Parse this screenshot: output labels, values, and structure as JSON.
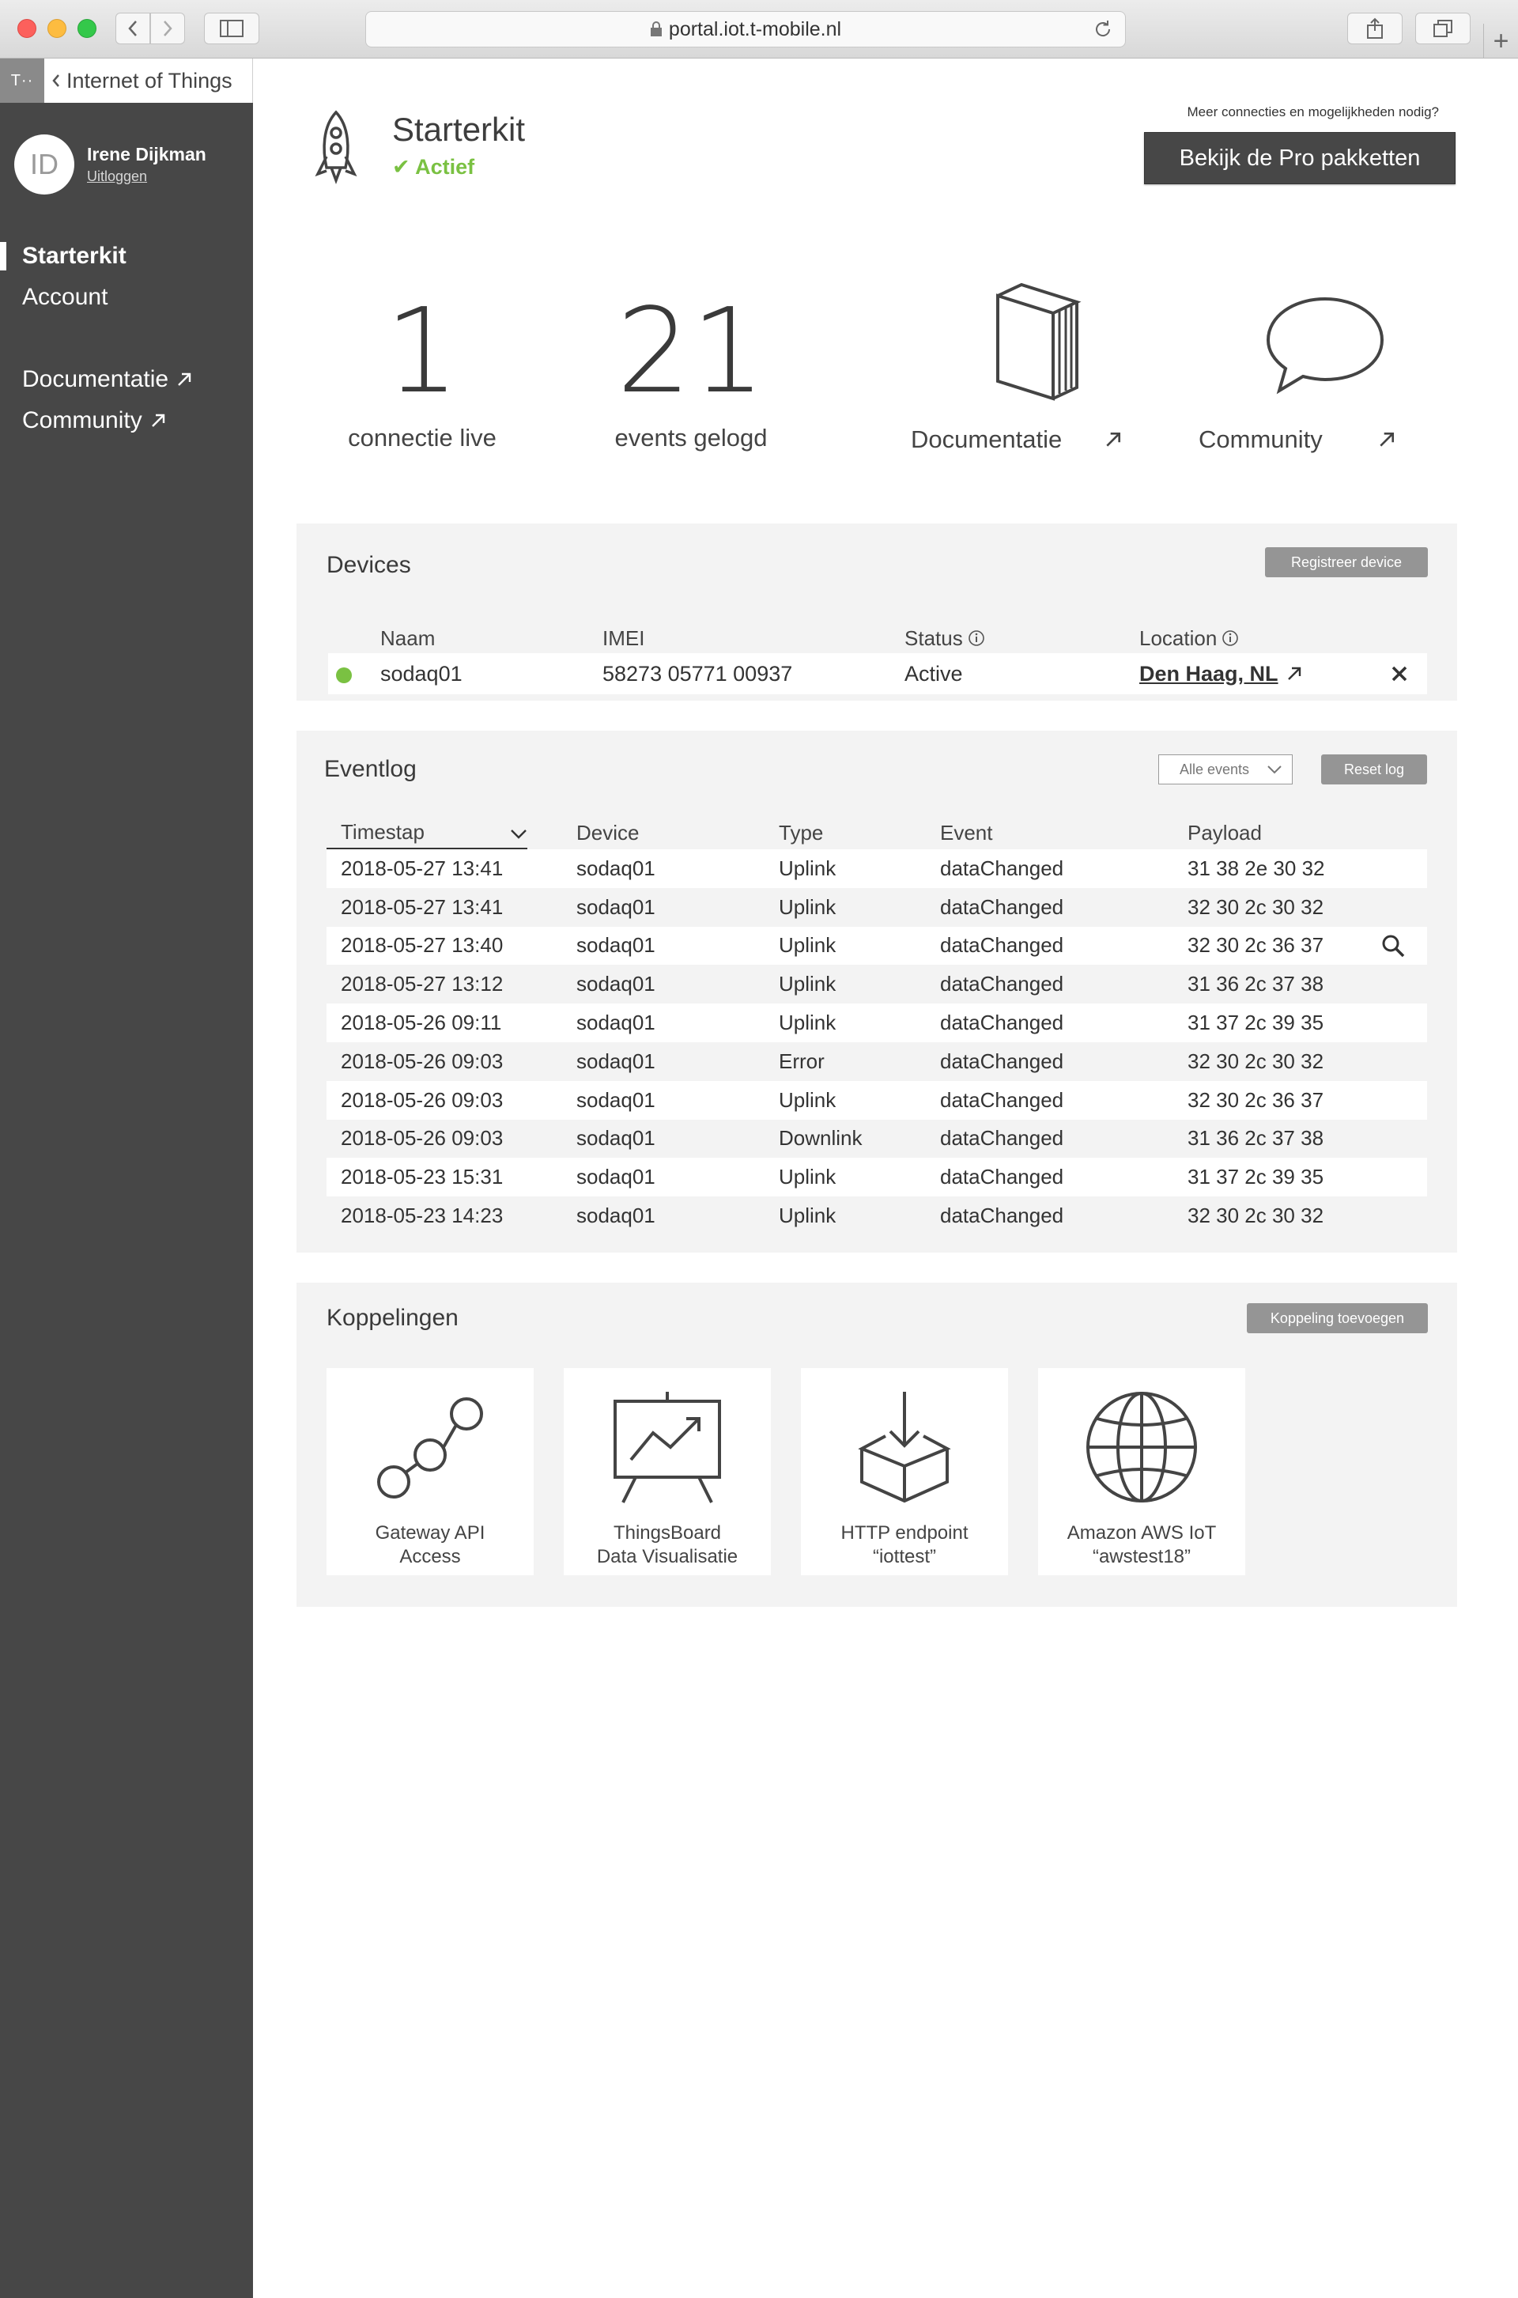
{
  "browser": {
    "url": "portal.iot.t-mobile.nl"
  },
  "sidebar": {
    "brand": "T··",
    "back_label": "Internet of Things",
    "user": {
      "initials": "ID",
      "name": "Irene Dijkman",
      "logout": "Uitloggen"
    },
    "nav": [
      {
        "label": "Starterkit",
        "active": true
      },
      {
        "label": "Account",
        "active": false
      }
    ],
    "links": [
      {
        "label": "Documentatie"
      },
      {
        "label": "Community"
      }
    ]
  },
  "header": {
    "title": "Starterkit",
    "status": "✔ Actief",
    "pro_note": "Meer connecties en mogelijkheden nodig?",
    "pro_button": "Bekijk de Pro pakketten"
  },
  "stats": [
    {
      "value": "1",
      "label": "connectie live"
    },
    {
      "value": "21",
      "label": "events gelogd"
    }
  ],
  "tiles": [
    {
      "label": "Documentatie",
      "icon": "book-icon"
    },
    {
      "label": "Community",
      "icon": "speech-bubble-icon"
    }
  ],
  "devices": {
    "title": "Devices",
    "register_button": "Registreer device",
    "columns": {
      "name": "Naam",
      "imei": "IMEI",
      "status": "Status",
      "location": "Location"
    },
    "rows": [
      {
        "name": "sodaq01",
        "imei": "58273 05771 00937",
        "status": "Active",
        "location": "Den Haag, NL"
      }
    ]
  },
  "eventlog": {
    "title": "Eventlog",
    "filter": "Alle events",
    "reset_button": "Reset log",
    "columns": {
      "timestamp": "Timestap",
      "device": "Device",
      "type": "Type",
      "event": "Event",
      "payload": "Payload"
    },
    "rows": [
      {
        "timestamp": "2018-05-27 13:41",
        "device": "sodaq01",
        "type": "Uplink",
        "event": "dataChanged",
        "payload": "31 38 2e 30 32"
      },
      {
        "timestamp": "2018-05-27 13:41",
        "device": "sodaq01",
        "type": "Uplink",
        "event": "dataChanged",
        "payload": "32 30 2c 30 32"
      },
      {
        "timestamp": "2018-05-27 13:40",
        "device": "sodaq01",
        "type": "Uplink",
        "event": "dataChanged",
        "payload": "32 30 2c 36 37"
      },
      {
        "timestamp": "2018-05-27 13:12",
        "device": "sodaq01",
        "type": "Uplink",
        "event": "dataChanged",
        "payload": "31 36 2c 37 38"
      },
      {
        "timestamp": "2018-05-26 09:11",
        "device": "sodaq01",
        "type": "Uplink",
        "event": "dataChanged",
        "payload": "31 37 2c 39 35"
      },
      {
        "timestamp": "2018-05-26 09:03",
        "device": "sodaq01",
        "type": "Error",
        "event": "dataChanged",
        "payload": "32 30 2c 30 32"
      },
      {
        "timestamp": "2018-05-26 09:03",
        "device": "sodaq01",
        "type": "Uplink",
        "event": "dataChanged",
        "payload": "32 30 2c 36 37"
      },
      {
        "timestamp": "2018-05-26 09:03",
        "device": "sodaq01",
        "type": "Downlink",
        "event": "dataChanged",
        "payload": "31 36 2c 37 38"
      },
      {
        "timestamp": "2018-05-23 15:31",
        "device": "sodaq01",
        "type": "Uplink",
        "event": "dataChanged",
        "payload": "31 37 2c 39 35"
      },
      {
        "timestamp": "2018-05-23 14:23",
        "device": "sodaq01",
        "type": "Uplink",
        "event": "dataChanged",
        "payload": "32 30 2c 30 32"
      }
    ]
  },
  "koppelingen": {
    "title": "Koppelingen",
    "add_button": "Koppeling toevoegen",
    "items": [
      {
        "line1": "Gateway API",
        "line2": "Access",
        "icon": "gateway-nodes-icon"
      },
      {
        "line1": "ThingsBoard",
        "line2": "Data Visualisatie",
        "icon": "presentation-chart-icon"
      },
      {
        "line1": "HTTP endpoint",
        "line2": "“iottest”",
        "icon": "download-box-icon"
      },
      {
        "line1": "Amazon AWS IoT",
        "line2": "“awstest18”",
        "icon": "globe-icon"
      }
    ]
  }
}
